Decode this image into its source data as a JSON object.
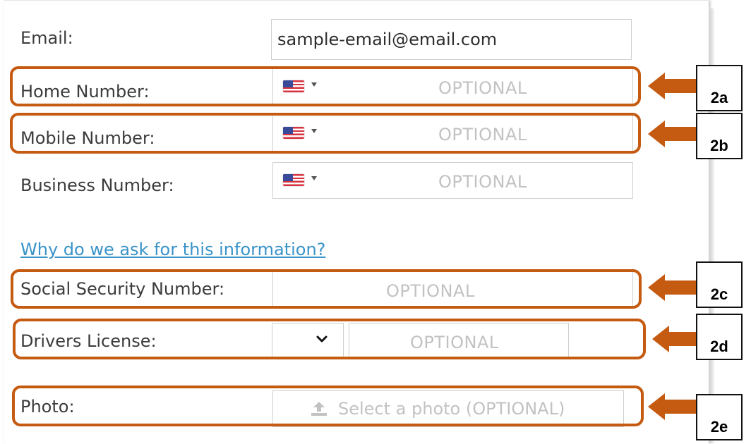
{
  "form": {
    "email": {
      "label": "Email:",
      "value": "sample-email@email.com"
    },
    "home_number": {
      "label": "Home Number:",
      "placeholder": "OPTIONAL",
      "country_icon": "us-flag-icon"
    },
    "mobile_number": {
      "label": "Mobile Number:",
      "placeholder": "OPTIONAL",
      "country_icon": "us-flag-icon"
    },
    "business_number": {
      "label": "Business Number:",
      "placeholder": "OPTIONAL",
      "country_icon": "us-flag-icon"
    },
    "why_link": "Why do we ask for this information?",
    "ssn": {
      "label": "Social Security Number:",
      "placeholder": "OPTIONAL"
    },
    "drivers_license": {
      "label": "Drivers License:",
      "placeholder": "OPTIONAL"
    },
    "photo": {
      "label": "Photo:",
      "button_text": "Select a photo (OPTIONAL)",
      "icon": "upload-icon"
    }
  },
  "annotations": {
    "tags": [
      "2a",
      "2b",
      "2c",
      "2d",
      "2e"
    ],
    "color": "#c55a11"
  }
}
